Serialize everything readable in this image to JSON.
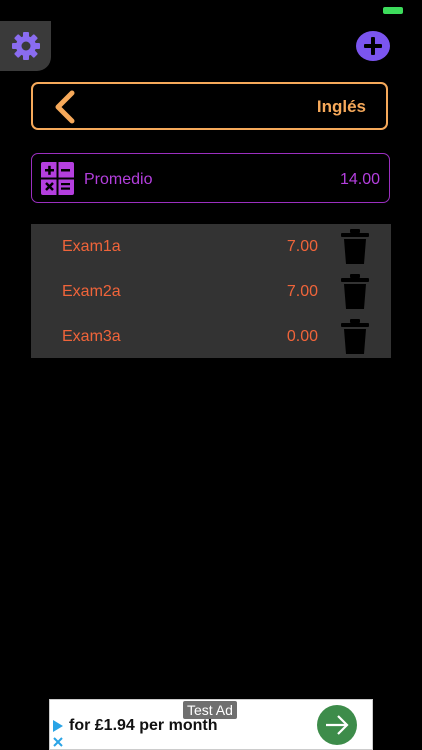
{
  "header": {
    "title": "Inglés"
  },
  "average": {
    "label": "Promedio",
    "value": "14.00"
  },
  "exams": [
    {
      "name": "Exam1a",
      "score": "7.00"
    },
    {
      "name": "Exam2a",
      "score": "7.00"
    },
    {
      "name": "Exam3a",
      "score": "0.00"
    }
  ],
  "ad": {
    "label": "Test Ad",
    "text": "for £1.94 per month"
  },
  "icons": {
    "settings": "gear-icon",
    "add": "plus-circle-icon",
    "back": "chevron-left-icon",
    "calculator": "calculator-icon",
    "delete": "trash-icon",
    "ad_info": "info-icon",
    "ad_go": "arrow-right-icon"
  },
  "colors": {
    "accent_orange": "#f6a95a",
    "accent_purple": "#b43fde",
    "score_text": "#f0643a",
    "settings_icon": "#8a6cf0",
    "add_button": "#7b55ef"
  }
}
